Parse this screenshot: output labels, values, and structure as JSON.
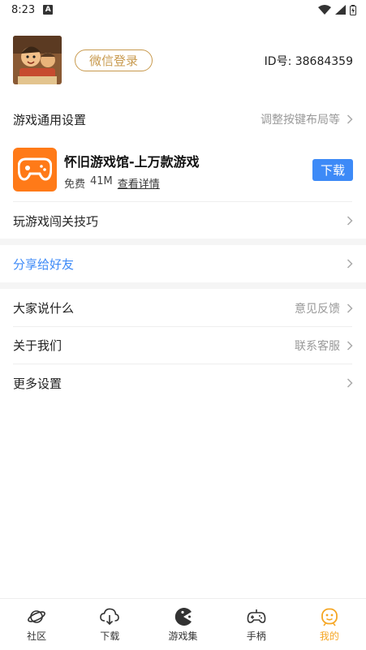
{
  "status_bar": {
    "time": "8:23",
    "badge": "A"
  },
  "profile": {
    "login_label": "微信登录",
    "user_id": "ID号: 38684359"
  },
  "menu": {
    "game_settings": {
      "label": "游戏通用设置",
      "hint": "调整按键布局等"
    },
    "promo": {
      "title": "怀旧游戏馆-上万款游戏",
      "price": "免费",
      "size": "41M",
      "detail": "查看详情",
      "download": "下载"
    },
    "tips": {
      "label": "玩游戏闯关技巧"
    },
    "share": {
      "label": "分享给好友"
    },
    "feedback": {
      "label": "大家说什么",
      "hint": "意见反馈"
    },
    "about": {
      "label": "关于我们",
      "hint": "联系客服"
    },
    "more": {
      "label": "更多设置"
    }
  },
  "tabs": [
    {
      "label": "社区",
      "icon": "planet-icon"
    },
    {
      "label": "下载",
      "icon": "cloud-download-icon"
    },
    {
      "label": "游戏集",
      "icon": "pacman-icon"
    },
    {
      "label": "手柄",
      "icon": "gamepad-icon"
    },
    {
      "label": "我的",
      "icon": "profile-face-icon",
      "active": true
    }
  ],
  "colors": {
    "accent": "#f5a623",
    "login_border": "#c89a4e",
    "download_button": "#3d8af7",
    "share_text": "#3d8af7",
    "promo_icon_bg": "#ff7a18"
  }
}
